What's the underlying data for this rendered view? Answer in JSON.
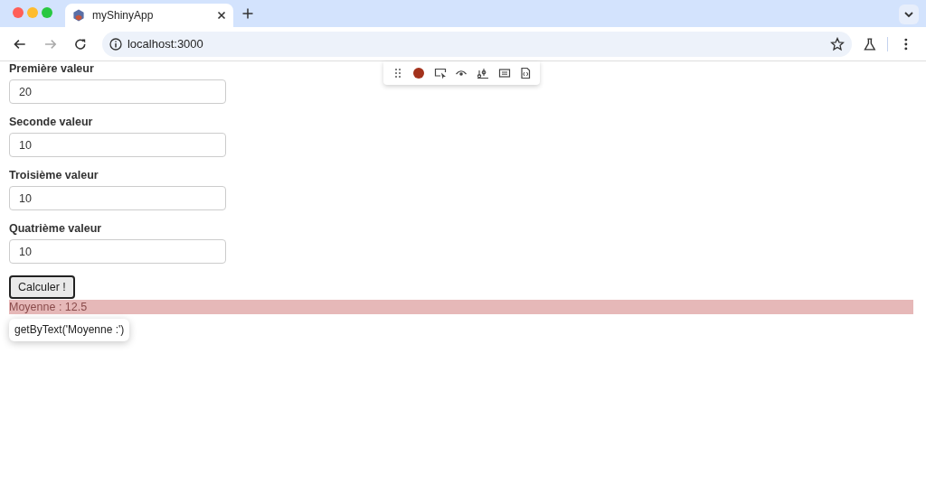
{
  "browser": {
    "tab": {
      "title": "myShinyApp"
    },
    "address": "localhost:3000"
  },
  "toolbar": {
    "recording": true
  },
  "fields": [
    {
      "label": "Première valeur",
      "value": "20"
    },
    {
      "label": "Seconde valeur",
      "value": "10"
    },
    {
      "label": "Troisième valeur",
      "value": "10"
    },
    {
      "label": "Quatrième valeur",
      "value": "10"
    }
  ],
  "button": "Calculer !",
  "result": {
    "text": "Moyenne : 12.5",
    "highlighted": true
  },
  "tooltip": "getByText('Moyenne :')"
}
